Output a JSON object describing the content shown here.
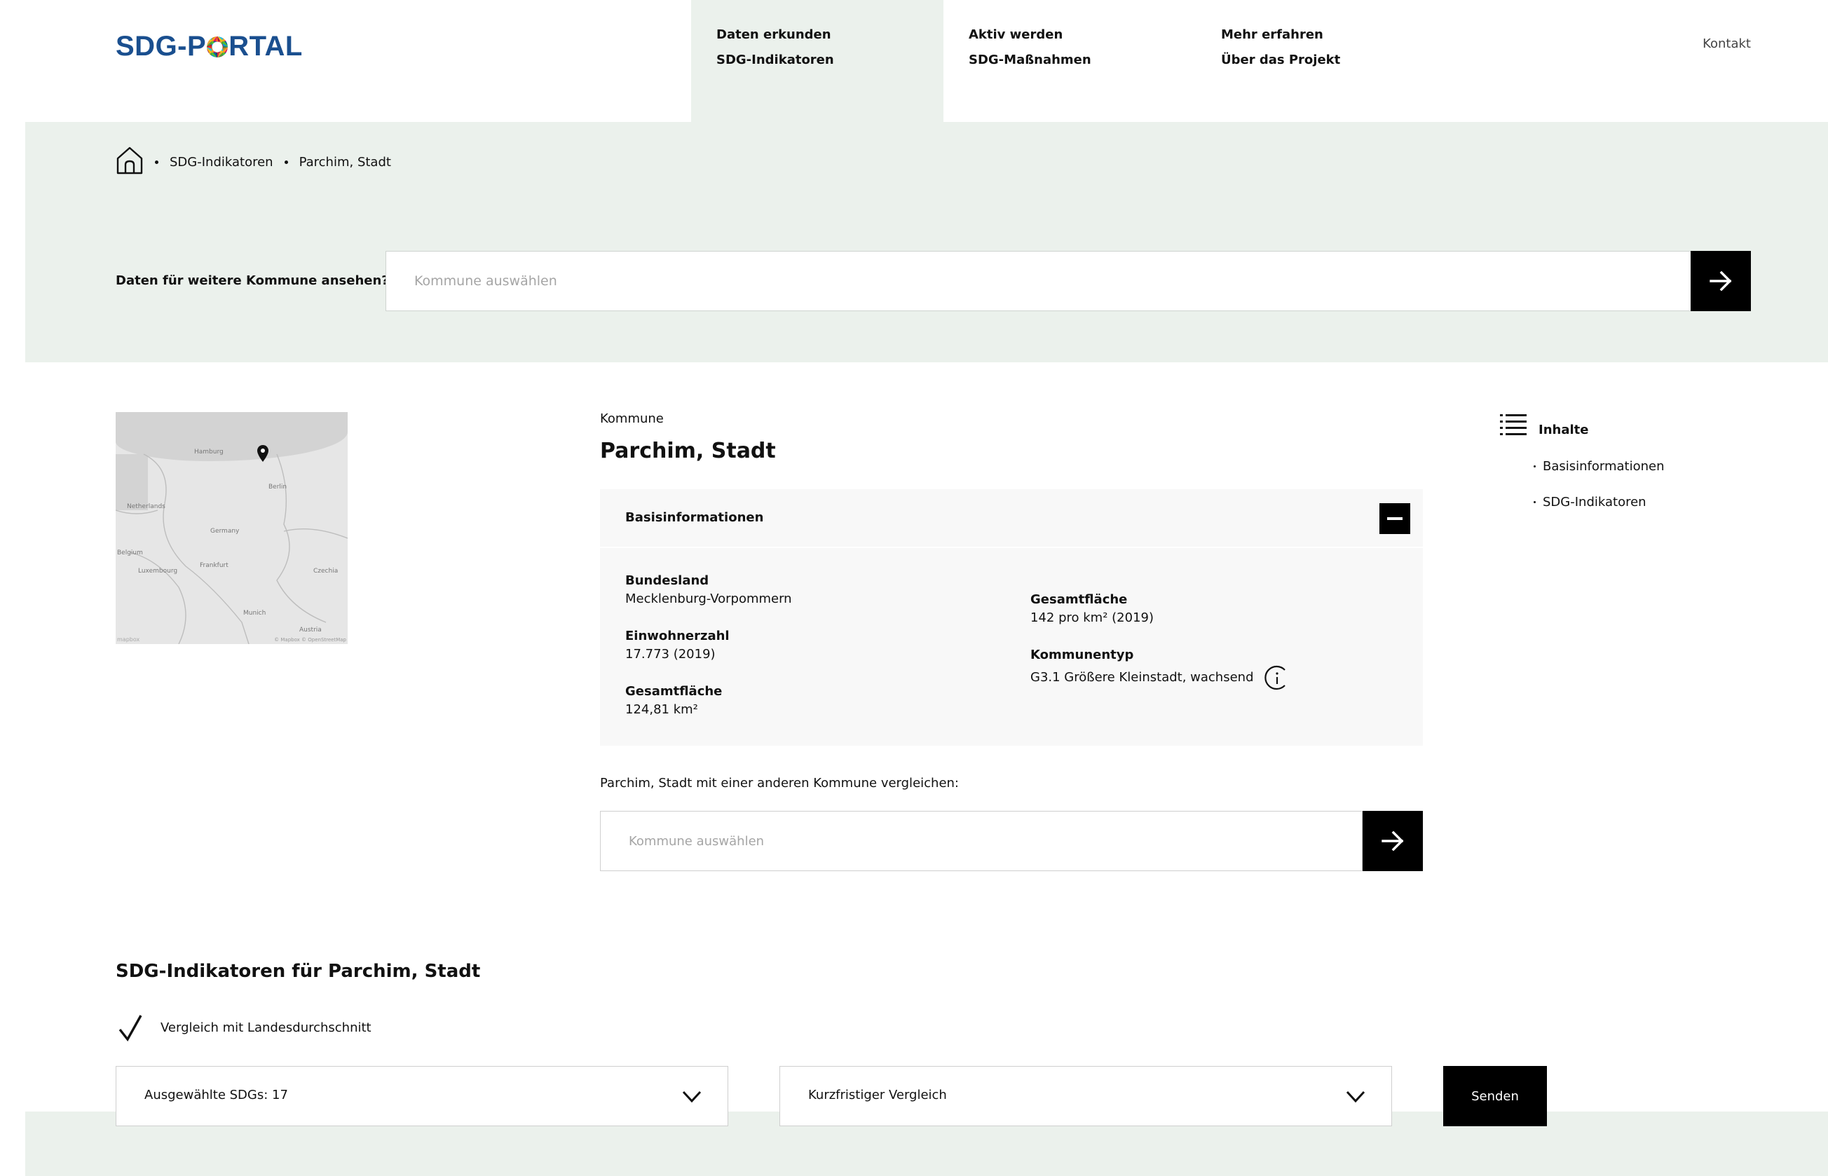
{
  "header": {
    "logo_left": "SDG-P",
    "logo_right": "RTAL",
    "nav": [
      {
        "top": "Daten erkunden",
        "sub": "SDG-Indikatoren"
      },
      {
        "top": "Aktiv werden",
        "sub": "SDG-Maßnahmen"
      },
      {
        "top": "Mehr erfahren",
        "sub": "Über das Projekt"
      }
    ],
    "kontakt": "Kontakt"
  },
  "breadcrumb": {
    "items": [
      "SDG-Indikatoren",
      "Parchim, Stadt"
    ]
  },
  "search": {
    "label": "Daten für weitere Kommune ansehen?",
    "placeholder": "Kommune auswählen"
  },
  "map": {
    "labels": [
      "Hamburg",
      "Netherlands",
      "Germany",
      "Belgium",
      "Czechia",
      "Austria",
      "Berlin",
      "Frankfurt",
      "Munich",
      "Luxembourg"
    ],
    "credit": "© Mapbox © OpenStreetMap",
    "logo": "mapbox"
  },
  "kommune": {
    "kicker": "Kommune",
    "title": "Parchim, Stadt"
  },
  "basis": {
    "title": "Basisinformationen",
    "left": [
      {
        "label": "Bundesland",
        "value": "Mecklenburg-Vorpommern"
      },
      {
        "label": "Einwohnerzahl",
        "value": "17.773 (2019)"
      },
      {
        "label": "Gesamtfläche",
        "value": "124,81 km²"
      }
    ],
    "right": [
      {
        "label": "Gesamtfläche",
        "value": "142 pro km² (2019)"
      },
      {
        "label": "Kommunentyp",
        "value": "G3.1 Größere Kleinstadt, wachsend"
      }
    ]
  },
  "compare": {
    "label": "Parchim, Stadt mit einer anderen Kommune vergleichen:",
    "placeholder": "Kommune auswählen"
  },
  "toc": {
    "title": "Inhalte",
    "items": [
      "Basisinformationen",
      "SDG-Indikatoren"
    ]
  },
  "sdg": {
    "heading": "SDG-Indikatoren für Parchim, Stadt",
    "checkbox_label": "Vergleich mit Landesdurchschnitt",
    "select_sdgs": "Ausgewählte SDGs: 17",
    "select_compare": "Kurzfristiger Vergleich",
    "send": "Senden"
  }
}
